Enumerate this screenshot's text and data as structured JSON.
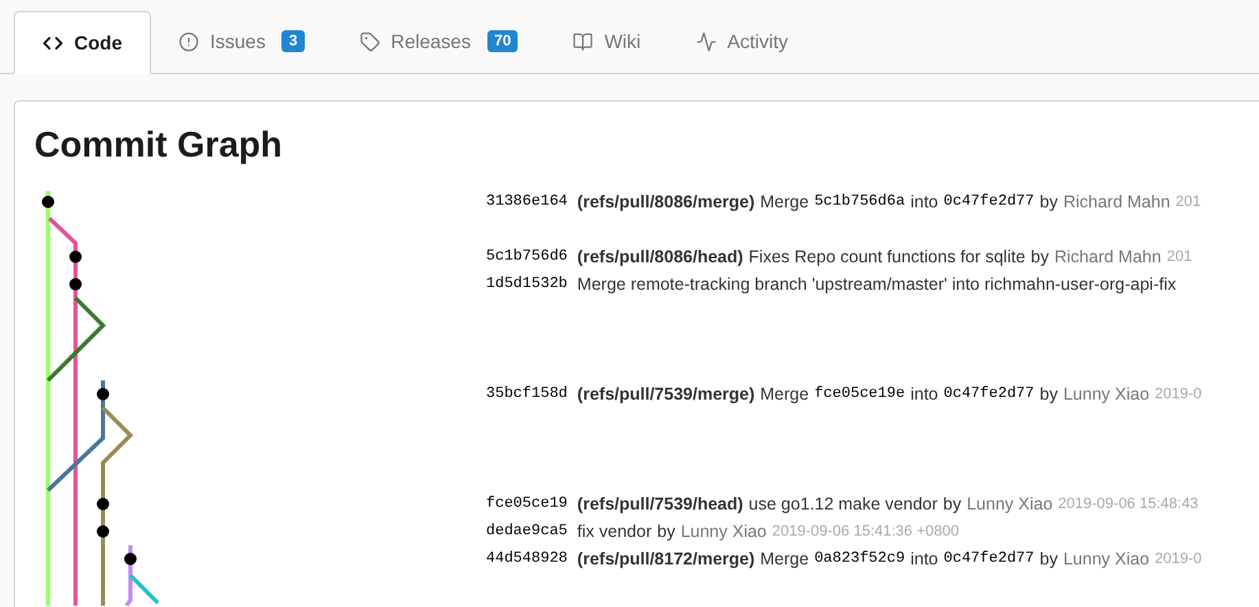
{
  "tabs": [
    {
      "label": "Code",
      "selected": true
    },
    {
      "label": "Issues",
      "badge": "3",
      "selected": false
    },
    {
      "label": "Releases",
      "badge": "70",
      "selected": false
    },
    {
      "label": "Wiki",
      "selected": false
    },
    {
      "label": "Activity",
      "selected": false
    }
  ],
  "title": "Commit Graph",
  "rows": [
    {
      "kind": "commit",
      "sha": "31386e164",
      "ref": "(refs/pull/8086/merge)",
      "message": [
        {
          "kind": "text",
          "text": "Merge"
        },
        {
          "kind": "code",
          "text": "5c1b756d6a"
        },
        {
          "kind": "text",
          "text": "into"
        },
        {
          "kind": "code",
          "text": "0c47fe2d77"
        },
        {
          "kind": "text",
          "text": "by"
        }
      ],
      "author": "Richard Mahn",
      "date": "201"
    },
    {
      "kind": "blank"
    },
    {
      "kind": "commit",
      "sha": "5c1b756d6",
      "ref": "(refs/pull/8086/head)",
      "message": [
        {
          "kind": "text",
          "text": "Fixes Repo count functions for sqlite"
        },
        {
          "kind": "text",
          "text": "by"
        }
      ],
      "author": "Richard Mahn",
      "date": "201"
    },
    {
      "kind": "commit",
      "sha": "1d5d1532b",
      "message": [
        {
          "kind": "text",
          "text": "Merge remote-tracking branch 'upstream/master' into richmahn-user-org-api-fix"
        }
      ]
    },
    {
      "kind": "blank"
    },
    {
      "kind": "blank"
    },
    {
      "kind": "blank"
    },
    {
      "kind": "commit",
      "sha": "35bcf158d",
      "ref": "(refs/pull/7539/merge)",
      "message": [
        {
          "kind": "text",
          "text": "Merge"
        },
        {
          "kind": "code",
          "text": "fce05ce19e"
        },
        {
          "kind": "text",
          "text": "into"
        },
        {
          "kind": "code",
          "text": "0c47fe2d77"
        },
        {
          "kind": "text",
          "text": "by"
        }
      ],
      "author": "Lunny Xiao",
      "date": "2019-0"
    },
    {
      "kind": "blank"
    },
    {
      "kind": "blank"
    },
    {
      "kind": "blank"
    },
    {
      "kind": "commit",
      "sha": "fce05ce19",
      "ref": "(refs/pull/7539/head)",
      "message": [
        {
          "kind": "text",
          "text": "use go1.12 make vendor"
        },
        {
          "kind": "text",
          "text": "by"
        }
      ],
      "author": "Lunny Xiao",
      "date": "2019-09-06 15:48:43"
    },
    {
      "kind": "commit",
      "sha": "dedae9ca5",
      "message": [
        {
          "kind": "text",
          "text": "fix vendor"
        },
        {
          "kind": "text",
          "text": "by"
        }
      ],
      "author": "Lunny Xiao",
      "date": "2019-09-06 15:41:36 +0800"
    },
    {
      "kind": "commit",
      "sha": "44d548928",
      "ref": "(refs/pull/8172/merge)",
      "message": [
        {
          "kind": "text",
          "text": "Merge"
        },
        {
          "kind": "code",
          "text": "0a823f52c9"
        },
        {
          "kind": "text",
          "text": "into"
        },
        {
          "kind": "code",
          "text": "0c47fe2d77"
        },
        {
          "kind": "text",
          "text": "by"
        }
      ],
      "author": "Lunny Xiao",
      "date": "2019-0"
    }
  ]
}
